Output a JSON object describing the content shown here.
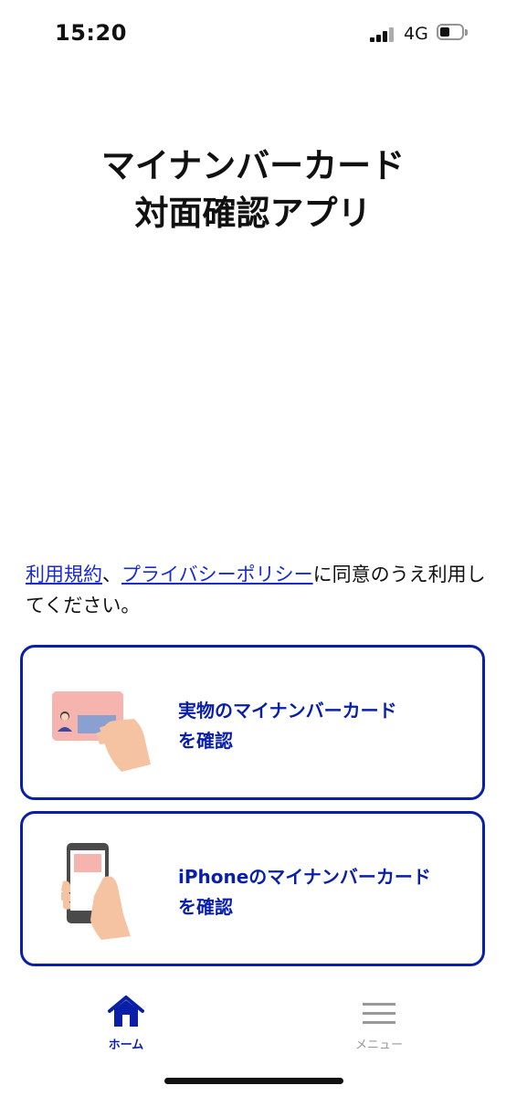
{
  "status_bar": {
    "time": "15:20",
    "network": "4G"
  },
  "title": {
    "line1": "マイナンバーカード",
    "line2": "対面確認アプリ"
  },
  "consent": {
    "terms_link": "利用規約",
    "separator": "、",
    "privacy_link": "プライバシーポリシー",
    "rest": "に同意のうえ利用してください。"
  },
  "buttons": [
    {
      "line1": "実物のマイナンバーカード",
      "line2": "を確認",
      "icon": "id-card-hand-icon"
    },
    {
      "line1": "iPhoneのマイナンバーカード",
      "line2": "を確認",
      "icon": "phone-hand-icon"
    }
  ],
  "tabs": [
    {
      "label": "ホーム",
      "icon": "home-icon",
      "active": true
    },
    {
      "label": "メニュー",
      "icon": "menu-icon",
      "active": false
    }
  ],
  "colors": {
    "accent": "#0a1fa8",
    "link": "#1a2bd0",
    "card_pink": "#f5b4ae",
    "skin": "#f6c3a2"
  }
}
